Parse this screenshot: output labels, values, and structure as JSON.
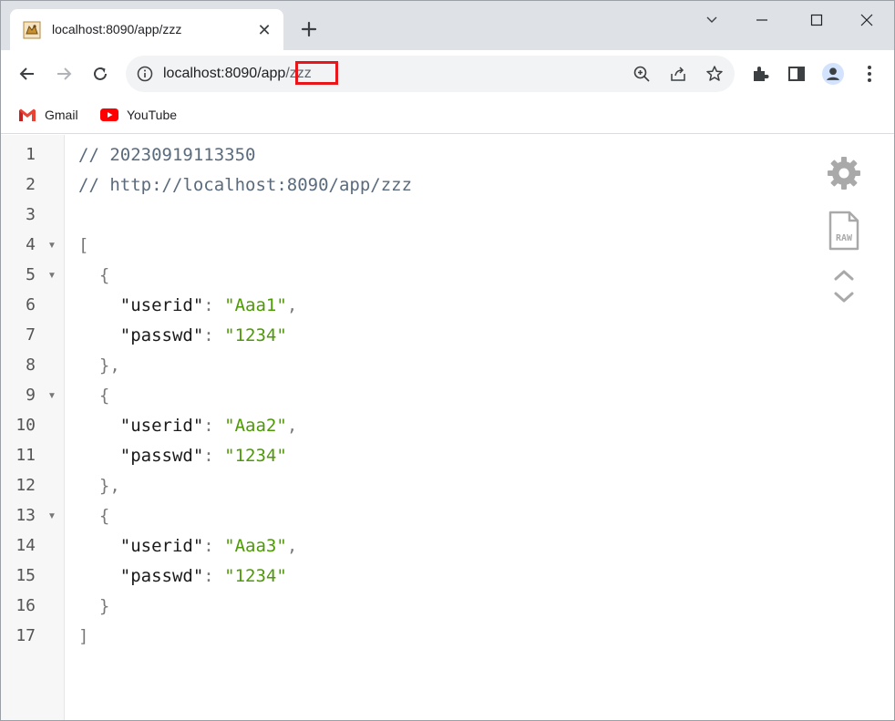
{
  "tab": {
    "title": "localhost:8090/app/zzz",
    "favicon": "tomcat-icon",
    "close_glyph": "✕"
  },
  "address_bar": {
    "host": "localhost:8090/app",
    "path": "/zzz"
  },
  "bookmarks": [
    {
      "label": "Gmail",
      "icon": "gmail-icon"
    },
    {
      "label": "YouTube",
      "icon": "youtube-icon"
    }
  ],
  "json_viewer": {
    "lines": [
      {
        "n": "1",
        "fold": "",
        "comment": "// 20230919113350"
      },
      {
        "n": "2",
        "fold": "",
        "comment": "// http://localhost:8090/app/zzz"
      },
      {
        "n": "3",
        "fold": ""
      },
      {
        "n": "4",
        "fold": "▼",
        "punct": "["
      },
      {
        "n": "5",
        "fold": "▼",
        "punct": "  {"
      },
      {
        "n": "6",
        "fold": "",
        "key": "\"userid\"",
        "value": "\"Aaa1\"",
        "trail": ","
      },
      {
        "n": "7",
        "fold": "",
        "key": "\"passwd\"",
        "value": "\"1234\"",
        "trail": ""
      },
      {
        "n": "8",
        "fold": "",
        "punct": "  },"
      },
      {
        "n": "9",
        "fold": "▼",
        "punct": "  {"
      },
      {
        "n": "10",
        "fold": "",
        "key": "\"userid\"",
        "value": "\"Aaa2\"",
        "trail": ","
      },
      {
        "n": "11",
        "fold": "",
        "key": "\"passwd\"",
        "value": "\"1234\"",
        "trail": ""
      },
      {
        "n": "12",
        "fold": "",
        "punct": "  },"
      },
      {
        "n": "13",
        "fold": "▼",
        "punct": "  {"
      },
      {
        "n": "14",
        "fold": "",
        "key": "\"userid\"",
        "value": "\"Aaa3\"",
        "trail": ","
      },
      {
        "n": "15",
        "fold": "",
        "key": "\"passwd\"",
        "value": "\"1234\"",
        "trail": ""
      },
      {
        "n": "16",
        "fold": "",
        "punct": "  }"
      },
      {
        "n": "17",
        "fold": "",
        "punct": "]"
      }
    ],
    "tools": [
      {
        "icon": "gear-icon"
      },
      {
        "icon": "raw-file-icon",
        "label": "RAW"
      },
      {
        "icon": "collapse-expand-icon"
      }
    ]
  },
  "colors": {
    "comment": "#5a6b7d",
    "string": "#4e9a06",
    "key": "#1a1a1a",
    "highlight": "#e8161b"
  }
}
